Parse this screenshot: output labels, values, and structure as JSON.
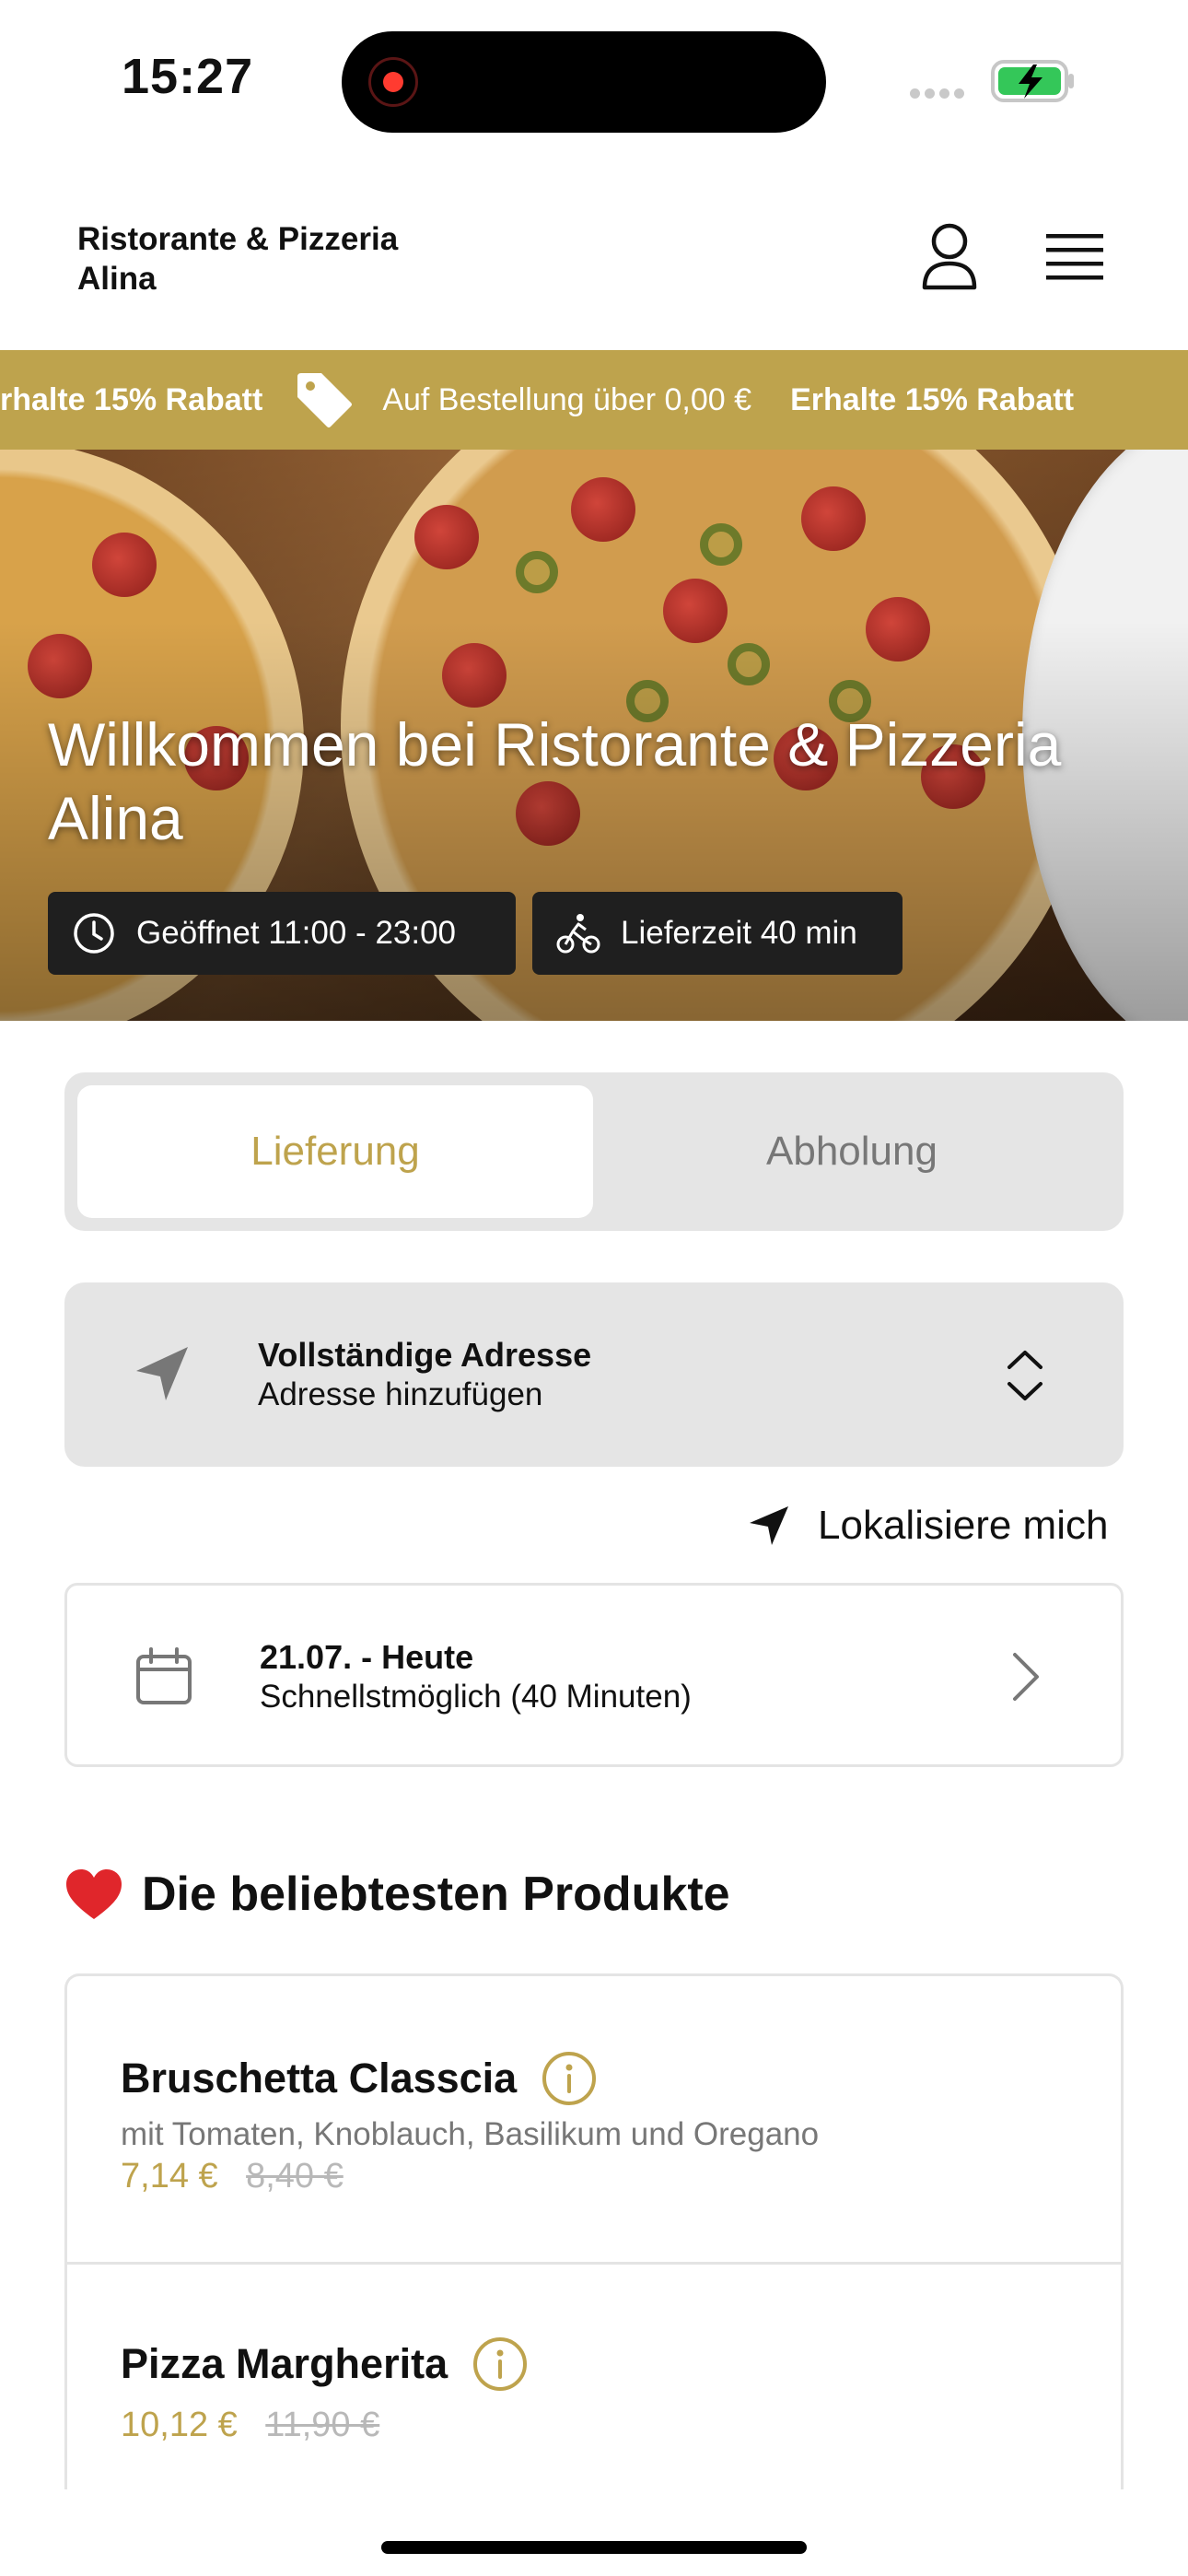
{
  "status_bar": {
    "time": "15:27"
  },
  "header": {
    "brand_line1": "Ristorante & Pizzeria",
    "brand_line2": "Alina"
  },
  "promo_banner": {
    "text_bold": "Erhalte 15% Rabatt",
    "text_bold_cut": "rhalte 15% Rabatt",
    "text_regular": "Auf Bestellung über 0,00 €"
  },
  "hero": {
    "title": "Willkommen bei Ristorante & Pizzeria Alina",
    "open_hours": "Geöffnet 11:00 - 23:00",
    "delivery_time": "Lieferzeit 40 min"
  },
  "order_mode": {
    "tabs": [
      "Lieferung",
      "Abholung"
    ],
    "active": "Lieferung"
  },
  "address": {
    "title": "Vollständige Adresse",
    "subtitle": "Adresse hinzufügen",
    "locate_label": "Lokalisiere mich"
  },
  "schedule": {
    "date": "21.07. - Heute",
    "time": "Schnellstmöglich (40 Minuten)"
  },
  "popular": {
    "title": "Die beliebtesten Produkte",
    "products": [
      {
        "name": "Bruschetta Classcia",
        "description": "mit Tomaten, Knoblauch, Basilikum und Oregano",
        "price": "7,14 €",
        "old_price": "8,40 €"
      },
      {
        "name": "Pizza Margherita",
        "description": "",
        "price": "10,12 €",
        "old_price": "11,90 €"
      }
    ]
  },
  "colors": {
    "accent": "#bea34d",
    "dark_chip": "#1f1f1f",
    "panel": "#e5e5e5"
  }
}
